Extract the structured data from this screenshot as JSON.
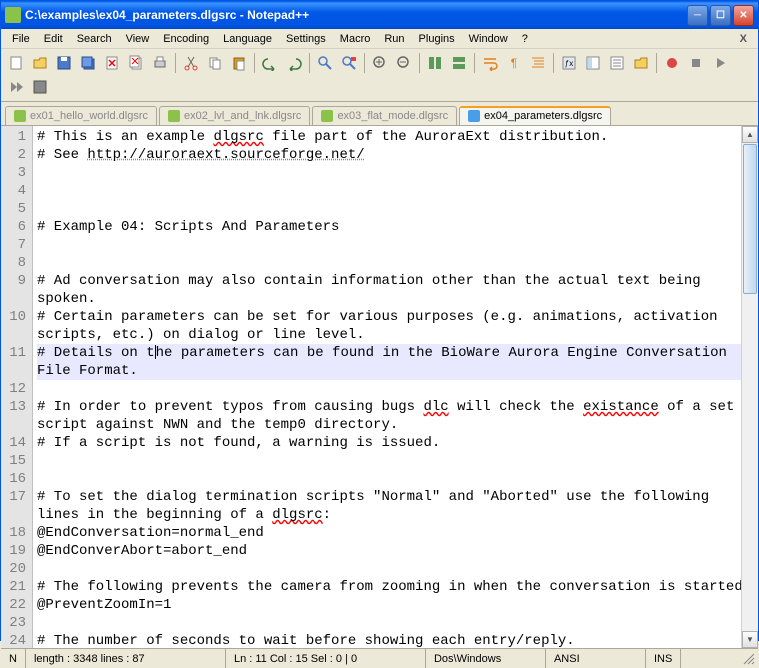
{
  "title": "C:\\examples\\ex04_parameters.dlgsrc - Notepad++",
  "menu": [
    "File",
    "Edit",
    "Search",
    "View",
    "Encoding",
    "Language",
    "Settings",
    "Macro",
    "Run",
    "Plugins",
    "Window",
    "?"
  ],
  "tabs": [
    {
      "label": "ex01_hello_world.dlgsrc",
      "active": false
    },
    {
      "label": "ex02_lvl_and_lnk.dlgsrc",
      "active": false
    },
    {
      "label": "ex03_flat_mode.dlgsrc",
      "active": false
    },
    {
      "label": "ex04_parameters.dlgsrc",
      "active": true
    }
  ],
  "lines": [
    {
      "n": "1",
      "t": "# This is an example <span class='spellerr'>dlgsrc</span> file part of the AuroraExt distribution."
    },
    {
      "n": "2",
      "t": "# See <span class='link'>http://auroraext.sourceforge.net/</span>"
    },
    {
      "n": "3",
      "t": ""
    },
    {
      "n": "4",
      "t": ""
    },
    {
      "n": "5",
      "t": ""
    },
    {
      "n": "6",
      "t": "# Example 04: Scripts And Parameters"
    },
    {
      "n": "7",
      "t": ""
    },
    {
      "n": "8",
      "t": ""
    },
    {
      "n": "9",
      "t": "# Ad conversation may also contain information other than the actual text being spoken.",
      "wrap": true
    },
    {
      "n": "10",
      "t": "# Certain parameters can be set for various purposes (e.g. animations, activation scripts, etc.) on dialog or line level.",
      "wrap": true
    },
    {
      "n": "11",
      "t": "# Details on t<span class='caret'></span>he parameters can be found in the BioWare Aurora Engine Conversation File Format.",
      "wrap": true,
      "current": true
    },
    {
      "n": "12",
      "t": ""
    },
    {
      "n": "13",
      "t": "# In order to prevent typos from causing bugs <span class='spellerr'>dlc</span> will check the <span class='spellerr'>existance</span> of a set script against NWN and the temp0 directory.",
      "wrap": true
    },
    {
      "n": "14",
      "t": "# If a script is not found, a warning is issued."
    },
    {
      "n": "15",
      "t": ""
    },
    {
      "n": "16",
      "t": ""
    },
    {
      "n": "17",
      "t": "# To set the dialog termination scripts \"Normal\" and \"Aborted\" use the following lines in the beginning of a <span class='spellerr'>dlgsrc</span>:",
      "wrap": true
    },
    {
      "n": "18",
      "t": "@EndConversation=normal_end"
    },
    {
      "n": "19",
      "t": "@EndConverAbort=abort_end"
    },
    {
      "n": "20",
      "t": ""
    },
    {
      "n": "21",
      "t": "# The following prevents the camera from zooming in when the conversation is started."
    },
    {
      "n": "22",
      "t": "@PreventZoomIn=1"
    },
    {
      "n": "23",
      "t": ""
    },
    {
      "n": "24",
      "t": "# The number of seconds to wait before showing each entry/reply."
    }
  ],
  "status": {
    "lang": "N",
    "length": "length : 3348    lines : 87",
    "pos": "Ln : 11   Col : 15   Sel : 0 | 0",
    "eol": "Dos\\Windows",
    "enc": "ANSI",
    "mode": "INS"
  }
}
